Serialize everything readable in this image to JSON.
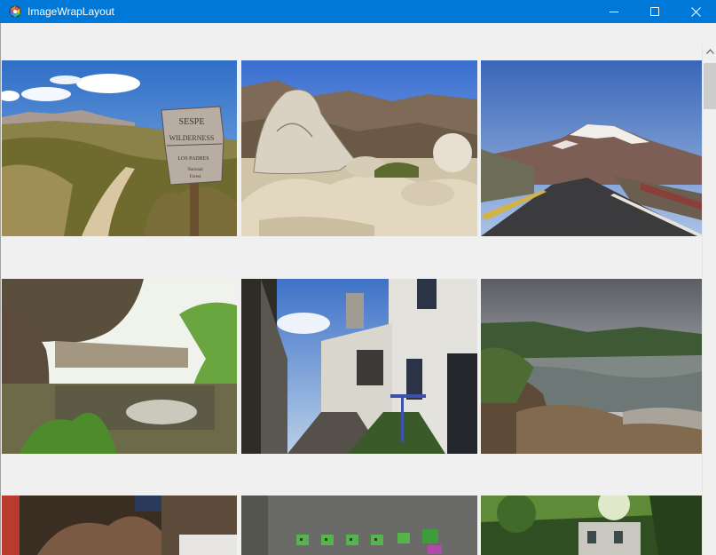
{
  "window": {
    "title": "ImageWrapLayout",
    "app_icon": "app-icon",
    "controls": [
      "minimize-icon",
      "maximize-icon",
      "close-icon"
    ]
  },
  "gallery": {
    "photos": [
      {
        "name": "trail-sign-photo",
        "subject": "trail sign in chaparral",
        "sign_text": [
          "SESPE",
          "WILDERNESS",
          "LOS PADRES",
          "National",
          "Forest"
        ]
      },
      {
        "name": "boulders-photo",
        "subject": "granite boulders and mountains"
      },
      {
        "name": "mountain-road-photo",
        "subject": "road toward snowy peak at dusk"
      },
      {
        "name": "cave-pool-photo",
        "subject": "cave overhang above pool"
      },
      {
        "name": "alley-buildings-photo",
        "subject": "alley between old white buildings"
      },
      {
        "name": "river-rocks-photo",
        "subject": "river with rocky shore"
      },
      {
        "name": "interior-photo",
        "subject": "dim interior"
      },
      {
        "name": "pixel-invaders-photo",
        "subject": "pixel art on wall"
      },
      {
        "name": "forest-building-photo",
        "subject": "trees and building"
      }
    ]
  },
  "scrollbar": {
    "position_fraction": 0.0
  }
}
